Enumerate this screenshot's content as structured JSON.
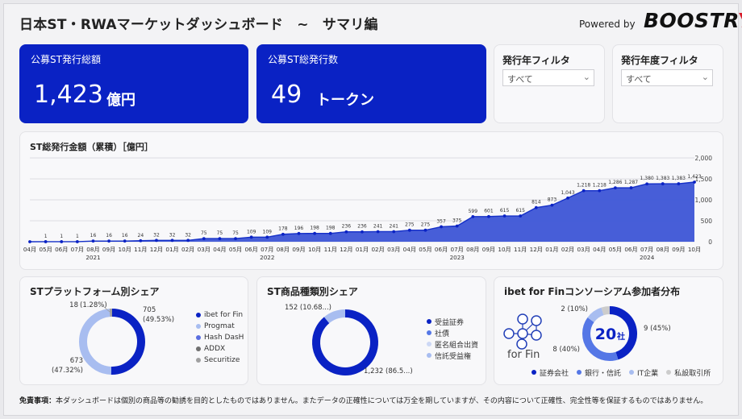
{
  "header": {
    "title": "日本ST・RWAマーケットダッシュボード　~　サマリ編",
    "powered_by": "Powered by",
    "brand": "BOOSTR",
    "brand_accent": "Y"
  },
  "kpis": {
    "issuance": {
      "label": "公募ST発行総額",
      "value": "1,423",
      "unit": "億円"
    },
    "count": {
      "label": "公募ST総発行数",
      "value": "49",
      "unit": "トークン"
    }
  },
  "filters": {
    "year": {
      "label": "発行年フィルタ",
      "value": "すべて"
    },
    "fiscal_year": {
      "label": "発行年度フィルタ",
      "value": "すべて"
    }
  },
  "colors": {
    "primary": "#0a22c4",
    "area": "#3d55d6",
    "light": "#a8bdf0",
    "gray": "#a0a0a0",
    "mid": "#5577e6"
  },
  "chart_data": [
    {
      "type": "area",
      "title": "ST総発行金額（累積）［億円］",
      "x": [
        "04月",
        "05月",
        "06月",
        "07月",
        "08月",
        "09月",
        "10月",
        "11月",
        "12月",
        "01月",
        "02月",
        "03月",
        "04月",
        "05月",
        "06月",
        "07月",
        "08月",
        "09月",
        "10月",
        "11月",
        "12月",
        "01月",
        "02月",
        "03月",
        "04月",
        "05月",
        "06月",
        "07月",
        "08月",
        "09月",
        "10月",
        "11月",
        "12月",
        "01月",
        "02月",
        "03月",
        "04月",
        "05月",
        "06月",
        "07月",
        "08月",
        "09月",
        "10月"
      ],
      "year_labels": [
        {
          "label": "2021",
          "index": 4
        },
        {
          "label": "2022",
          "index": 15
        },
        {
          "label": "2023",
          "index": 27
        },
        {
          "label": "2024",
          "index": 39
        }
      ],
      "values": [
        0,
        1,
        1,
        1,
        16,
        16,
        16,
        24,
        32,
        32,
        32,
        75,
        75,
        75,
        109,
        109,
        178,
        196,
        198,
        198,
        236,
        236,
        241,
        241,
        275,
        275,
        357,
        375,
        599,
        601,
        615,
        615,
        814,
        873,
        1043,
        1218,
        1218,
        1286,
        1287,
        1380,
        1383,
        1383,
        1423
      ],
      "data_labels": [
        "",
        "1",
        "1",
        "1",
        "16",
        "16",
        "16",
        "24",
        "32",
        "32",
        "32",
        "75",
        "75",
        "75",
        "109",
        "109",
        "178",
        "196",
        "198",
        "198",
        "236",
        "236",
        "241",
        "241",
        "275",
        "275",
        "357",
        "375",
        "599",
        "601",
        "615",
        "615",
        "814",
        "873",
        "1,043",
        "1,218",
        "1,218",
        "1,286",
        "1,287",
        "1,380",
        "1,383",
        "1,383",
        "1,423"
      ],
      "ylim": [
        0,
        2000
      ],
      "yticks": [
        0,
        500,
        1000,
        1500,
        2000
      ],
      "ytick_labels": [
        "0",
        "500",
        "1,000",
        "1,500",
        "2,000"
      ],
      "grid": true
    },
    {
      "type": "pie",
      "title": "STプラットフォーム別シェア",
      "slices": [
        {
          "name": "ibet for Fin",
          "value": 705,
          "label": "705",
          "pct": "(49.53%)",
          "color": "#0a22c4"
        },
        {
          "name": "Progmat",
          "value": 673,
          "label": "673",
          "pct": "(47.32%)",
          "color": "#a8bdf0"
        },
        {
          "name": "Hash DasH",
          "value": 0,
          "color": "#5a6ee0"
        },
        {
          "name": "ADDX",
          "value": 0,
          "color": "#707070"
        },
        {
          "name": "Securitize",
          "value": 18,
          "label": "18",
          "pct": "(1.28%)",
          "color": "#a0a0a0"
        }
      ]
    },
    {
      "type": "pie",
      "title": "ST商品種類別シェア",
      "slices": [
        {
          "name": "受益証券",
          "value": 1232,
          "label": "1,232 (86.5...)",
          "color": "#0a22c4"
        },
        {
          "name": "社債",
          "value": 0,
          "color": "#5577e6"
        },
        {
          "name": "匿名組合出資",
          "value": 0,
          "color": "#cdd8f5"
        },
        {
          "name": "信託受益権",
          "value": 152,
          "label": "152 (10.68...)",
          "color": "#a8bdf0"
        }
      ]
    },
    {
      "type": "pie",
      "title": "ibet for Finコンソーシアム参加者分布",
      "center_value": "20",
      "center_unit": "社",
      "slices": [
        {
          "name": "証券会社",
          "value": 9,
          "label": "9 (45%)",
          "color": "#0a22c4"
        },
        {
          "name": "銀行・信託",
          "value": 8,
          "label": "8 (40%)",
          "color": "#5577e6"
        },
        {
          "name": "IT企業",
          "value": 2,
          "label": "2 (10%)",
          "color": "#a8bdf0"
        },
        {
          "name": "私設取引所",
          "value": 1,
          "color": "#cccccc"
        }
      ]
    }
  ],
  "logo_text": "for Fin",
  "disclaimer": {
    "label": "免責事項：",
    "text": "本ダッシュボードは個別の商品等の勧誘を目的としたものではありません。またデータの正確性については万全を期していますが、その内容について正確性、完全性等を保証するものではありません。"
  }
}
